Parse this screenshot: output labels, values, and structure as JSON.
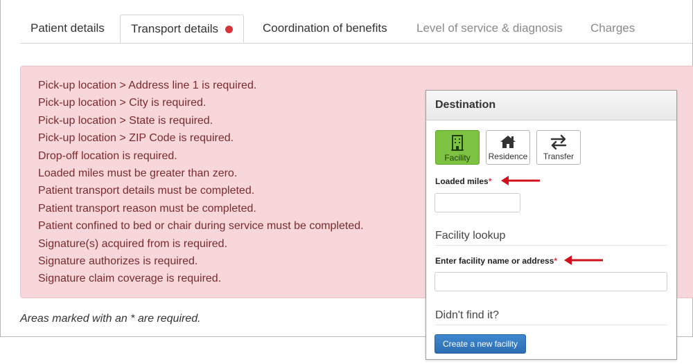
{
  "tabs": [
    {
      "label": "Patient details",
      "state": "normal"
    },
    {
      "label": "Transport details",
      "state": "active",
      "has_error": true
    },
    {
      "label": "Coordination of benefits",
      "state": "normal"
    },
    {
      "label": "Level of service & diagnosis",
      "state": "disabled"
    },
    {
      "label": "Charges",
      "state": "disabled"
    }
  ],
  "errors": [
    "Pick-up location > Address line 1 is required.",
    "Pick-up location > City is required.",
    "Pick-up location > State is required.",
    "Pick-up location > ZIP Code is required.",
    "Drop-off location is required.",
    "Loaded miles must be greater than zero.",
    "Patient transport details must be completed.",
    "Patient transport reason must be completed.",
    "Patient confined to bed or chair during service must be completed.",
    "Signature(s) acquired from is required.",
    "Signature authorizes is required.",
    "Signature claim coverage is required."
  ],
  "required_note": "Areas marked with an * are required.",
  "destination": {
    "title": "Destination",
    "types": [
      {
        "label": "Facility",
        "icon": "building-icon",
        "selected": true
      },
      {
        "label": "Residence",
        "icon": "house-icon",
        "selected": false
      },
      {
        "label": "Transfer",
        "icon": "swap-arrows-icon",
        "selected": false
      }
    ],
    "loaded_miles_label": "Loaded miles",
    "loaded_miles_value": "",
    "required_mark": "*",
    "facility_lookup_title": "Facility lookup",
    "facility_search_label": "Enter facility name or address",
    "facility_search_value": "",
    "didnt_find_title": "Didn't find it?",
    "create_button_label": "Create a new facility"
  },
  "colors": {
    "error_dot": "#d9343c",
    "alert_bg": "#f8d7da",
    "alert_text": "#7a2a2f",
    "selected_type": "#7ec242",
    "primary_button": "#2d6db3",
    "annotation_arrow": "#d0101a"
  }
}
